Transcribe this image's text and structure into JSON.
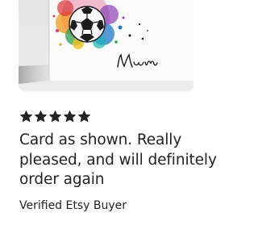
{
  "product_image": {
    "signature_text": "Mum",
    "alt": ""
  },
  "review": {
    "rating": 5,
    "rating_max": 5,
    "star_color": "#222222",
    "text": "Card as shown. Really pleased, and will definitely order again",
    "reviewer": "Verified Etsy Buyer"
  }
}
